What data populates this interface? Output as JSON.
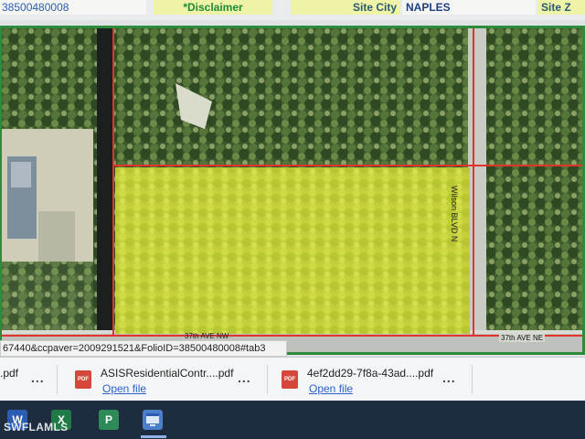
{
  "header": {
    "parcel_fragment": "38500480008",
    "disclaimer_link": "*Disclaimer",
    "site_city_label": "Site City",
    "site_city_value": "NAPLES",
    "site_label_partial": "Site Z"
  },
  "map": {
    "road_labels": {
      "west_road": "37th AVE NW",
      "east_road": "37th AVE NE",
      "blvd": "Wilson BLVD N"
    },
    "colors": {
      "parcel_highlight": "#d9e83a",
      "parcel_outline": "#e0342c",
      "frame": "#2d8b3b"
    }
  },
  "address_bar": {
    "url_text": "67440&ccpaver=2009291521&FolioID=38500480008#tab3"
  },
  "downloads": {
    "items": [
      {
        "name": ".pdf",
        "open_label": ""
      },
      {
        "name": "ASISResidentialContr....pdf",
        "open_label": "Open file"
      },
      {
        "name": "4ef2dd29-7f8a-43ad....pdf",
        "open_label": "Open file"
      }
    ],
    "more_label": "...",
    "file_type": "PDF"
  },
  "taskbar": {
    "apps": [
      {
        "label": "W",
        "icon": "word-icon"
      },
      {
        "label": "X",
        "icon": "excel-icon"
      },
      {
        "label": "P",
        "icon": "project-icon"
      },
      {
        "label": "",
        "icon": "app-window-icon"
      }
    ]
  },
  "watermark": "SWFLAMLS"
}
